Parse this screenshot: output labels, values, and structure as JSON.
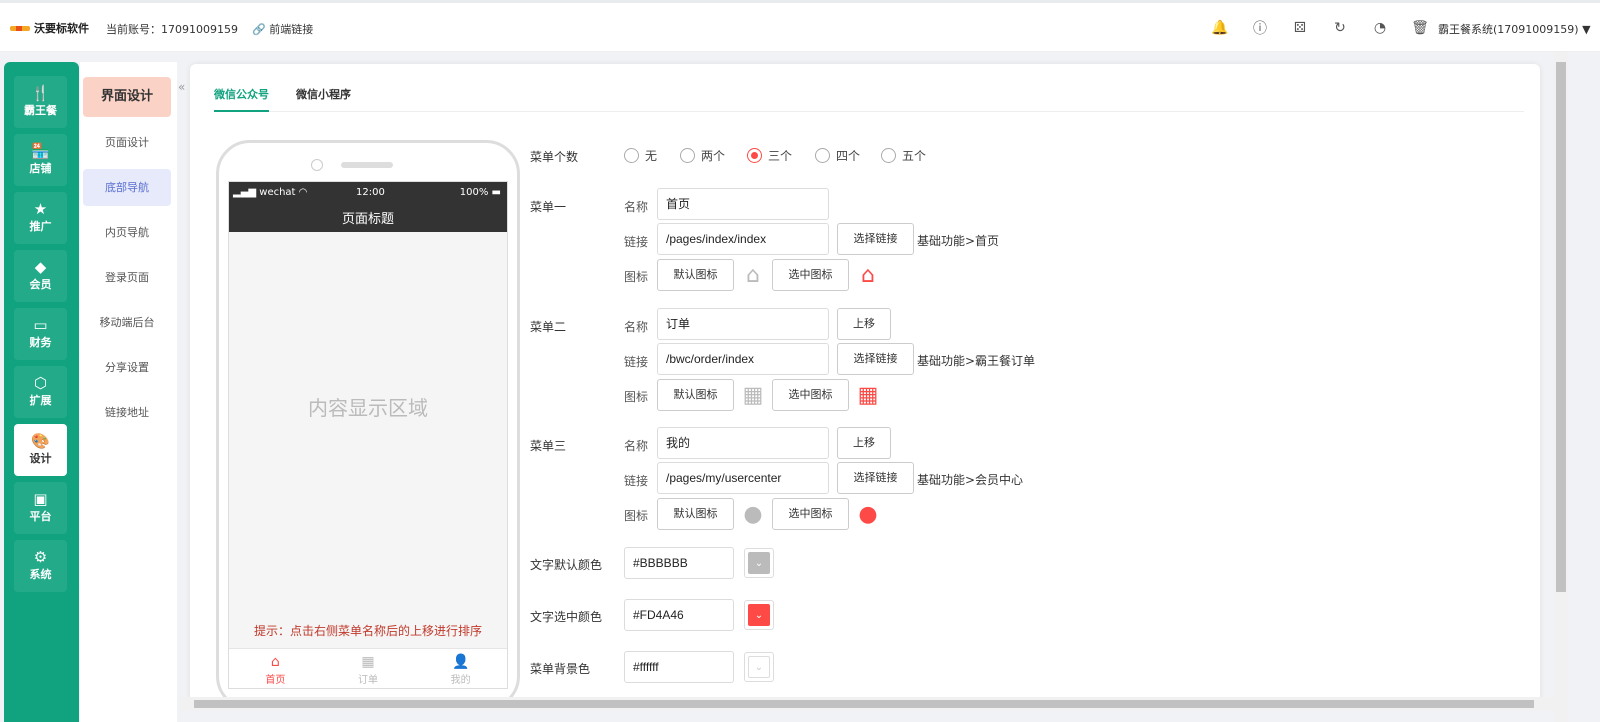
{
  "topbar": {
    "brand": "沃要标软件",
    "account": "当前账号：17091009159",
    "front_link": "前端链接",
    "system": "霸王餐系统(17091009159)"
  },
  "topbar_icons": [
    "bell-icon",
    "info-icon",
    "dice-icon",
    "refresh-icon",
    "dashboard-icon",
    "trash-icon"
  ],
  "leftnav": [
    {
      "label": "霸王餐",
      "icon": "utensils-icon",
      "glyph": "🍴"
    },
    {
      "label": "店铺",
      "icon": "store-icon",
      "glyph": "🏪"
    },
    {
      "label": "推广",
      "icon": "star-icon",
      "glyph": "★"
    },
    {
      "label": "会员",
      "icon": "diamond-icon",
      "glyph": "◆"
    },
    {
      "label": "财务",
      "icon": "wallet-icon",
      "glyph": "▭"
    },
    {
      "label": "扩展",
      "icon": "cube-icon",
      "glyph": "⬡"
    },
    {
      "label": "设计",
      "icon": "palette-icon",
      "glyph": "🎨"
    },
    {
      "label": "平台",
      "icon": "platform-icon",
      "glyph": "▣"
    },
    {
      "label": "系统",
      "icon": "settings-icon",
      "glyph": "⚙"
    }
  ],
  "subnav": {
    "header": "界面设计",
    "items": [
      "页面设计",
      "底部导航",
      "内页导航",
      "登录页面",
      "移动端后台",
      "分享设置",
      "链接地址"
    ]
  },
  "tabs": [
    "微信公众号",
    "微信小程序"
  ],
  "phone": {
    "carrier": "wechat",
    "time": "12:00",
    "battery": "100%",
    "page_title": "页面标题",
    "content": "内容显示区域",
    "hint": "提示：点击右侧菜单名称后的上移进行排序",
    "tabbar": [
      "首页",
      "订单",
      "我的"
    ]
  },
  "form": {
    "count_label": "菜单个数",
    "count_options": [
      "无",
      "两个",
      "三个",
      "四个",
      "五个"
    ],
    "count_selected": "三个",
    "name_label": "名称",
    "link_label": "链接",
    "icon_label": "图标",
    "select_link": "选择链接",
    "default_icon": "默认图标",
    "selected_icon": "选中图标",
    "move_up": "上移",
    "menus": [
      {
        "label": "菜单一",
        "name": "首页",
        "link": "/pages/index/index",
        "path": "基础功能>首页",
        "icon": "home-icon"
      },
      {
        "label": "菜单二",
        "name": "订单",
        "link": "/bwc/order/index",
        "path": "基础功能>霸王餐订单",
        "icon": "grid-icon"
      },
      {
        "label": "菜单三",
        "name": "我的",
        "link": "/pages/my/usercenter",
        "path": "基础功能>会员中心",
        "icon": "user-icon"
      }
    ],
    "text_default_color_label": "文字默认颜色",
    "text_default_color": "#BBBBBB",
    "text_selected_color_label": "文字选中颜色",
    "text_selected_color": "#FD4A46",
    "bg_color_label": "菜单背景色",
    "bg_color": "#ffffff"
  },
  "colors": {
    "accent": "#11a37f",
    "selected": "#fd4a46",
    "default": "#bbbbbb"
  }
}
